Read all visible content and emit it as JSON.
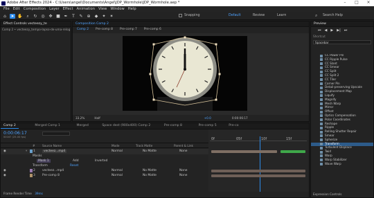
{
  "title": "Adobe After Effects 2024 - C:\\Users\\angel\\Documents\\Angel\\JDP_Wormhole\\JDP_Wormhole.aep *",
  "menu": [
    "File",
    "Edit",
    "Composition",
    "Layer",
    "Effect",
    "Animation",
    "View",
    "Window",
    "Help"
  ],
  "toolbar": {
    "snapping": "Snapping",
    "workspaces": [
      "Default",
      "Review",
      "Learn"
    ],
    "search": "Search Help"
  },
  "project": {
    "tab": "Effect Controls  vecteezy_te",
    "subtitle": "Comp 2 • vecteezy_tempo-lapso-de-uma-relog"
  },
  "viewer": {
    "tab": "Composition  Comp 2",
    "nav": [
      "Comp 2",
      "Pre-comp 8",
      "Pre-comp 7",
      "Pre-comp 6"
    ],
    "zoom": "33.2%",
    "quality": "Half",
    "exposure": "+0.0",
    "timecode": "0:00:06:17"
  },
  "right": {
    "preview": "Preview",
    "shortcut": "Shortcut",
    "shortcut_value": "Spacebar",
    "effects": [
      "CC Power Pin",
      "CC Ripple Pulse",
      "CC Slant",
      "CC Smear",
      "CC Split",
      "CC Split 2",
      "CC Tiler",
      "Corner Pin",
      "Detail-preserving Upscale",
      "Displacement Map",
      "Liquify",
      "Magnify",
      "Mesh Warp",
      "Mirror",
      "Offset",
      "Optics Compensation",
      "Polar Coordinates",
      "Reshape",
      "Ripple",
      "Rolling Shutter Repair",
      "Smear",
      "Spherize",
      "Transform",
      "Turbulent Displace",
      "Twirl",
      "Warp",
      "Warp Stabilizer",
      "Wave Warp"
    ],
    "selected": "Transform",
    "footer": "Expression Controls"
  },
  "timeline": {
    "tabs": [
      "Comp 2",
      "Merged Comp 1",
      "Merged",
      "Space dest (900x400) Comp 2",
      "Pre-comp 8",
      "Pre-comp 5",
      "Pre-co"
    ],
    "timecode": "0:00:06:17",
    "frames": "00167 (25.00 fps)",
    "columns": {
      "num": "#",
      "name": "Source Name",
      "mode": "Mode",
      "trkmat": "Track Matte",
      "parent": "Parent & Link"
    },
    "ruler": [
      "0f",
      "05f",
      "10f",
      "15f"
    ],
    "layers": [
      {
        "num": "1",
        "name": "vecteez...mp4",
        "mode": "Normal",
        "matte": "No Matte",
        "parent": "None"
      },
      {
        "name": "Masks"
      },
      {
        "name": "Mask 1",
        "mode": "Add",
        "extra": "Inverted"
      },
      {
        "name": "Transform",
        "extra": "Reset"
      },
      {
        "num": "2",
        "name": "vecteez...mp4",
        "mode": "Normal",
        "matte": "No Matte",
        "parent": "None"
      },
      {
        "num": "3",
        "name": "Pre-comp 8",
        "mode": "Normal",
        "matte": "No Matte",
        "parent": "None"
      }
    ],
    "footer": {
      "label": "Frame Render Time",
      "value": "39ms"
    }
  }
}
